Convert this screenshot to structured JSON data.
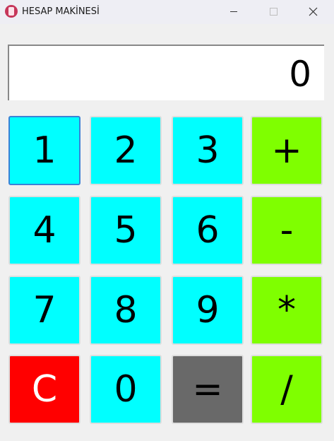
{
  "window": {
    "title": "HESAP MAKİNESİ",
    "icon": "calculator-icon",
    "icon_color": "#c6365a"
  },
  "display": {
    "value": "0"
  },
  "keypad": {
    "row1": [
      "1",
      "2",
      "3",
      "+"
    ],
    "row2": [
      "4",
      "5",
      "6",
      "-"
    ],
    "row3": [
      "7",
      "8",
      "9",
      "*"
    ],
    "row4": [
      "C",
      "0",
      "=",
      "/"
    ]
  },
  "colors": {
    "digit": "#00ffff",
    "operator": "#7fff00",
    "clear": "#ff0000",
    "equals": "#696969",
    "focus": "#3b82d6"
  }
}
